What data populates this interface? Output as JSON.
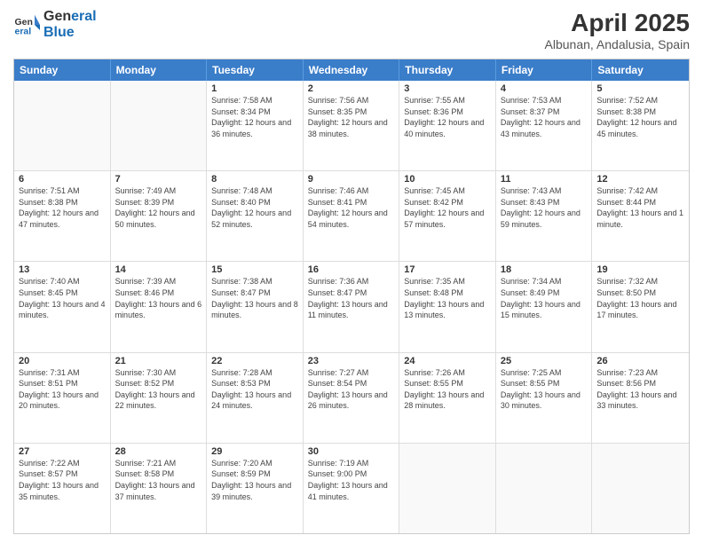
{
  "logo": {
    "line1": "General",
    "line2": "Blue"
  },
  "title": "April 2025",
  "subtitle": "Albunan, Andalusia, Spain",
  "header_days": [
    "Sunday",
    "Monday",
    "Tuesday",
    "Wednesday",
    "Thursday",
    "Friday",
    "Saturday"
  ],
  "rows": [
    [
      {
        "day": "",
        "empty": true
      },
      {
        "day": "",
        "empty": true
      },
      {
        "day": "1",
        "sunrise": "7:58 AM",
        "sunset": "8:34 PM",
        "daylight": "12 hours and 36 minutes."
      },
      {
        "day": "2",
        "sunrise": "7:56 AM",
        "sunset": "8:35 PM",
        "daylight": "12 hours and 38 minutes."
      },
      {
        "day": "3",
        "sunrise": "7:55 AM",
        "sunset": "8:36 PM",
        "daylight": "12 hours and 40 minutes."
      },
      {
        "day": "4",
        "sunrise": "7:53 AM",
        "sunset": "8:37 PM",
        "daylight": "12 hours and 43 minutes."
      },
      {
        "day": "5",
        "sunrise": "7:52 AM",
        "sunset": "8:38 PM",
        "daylight": "12 hours and 45 minutes."
      }
    ],
    [
      {
        "day": "6",
        "sunrise": "7:51 AM",
        "sunset": "8:38 PM",
        "daylight": "12 hours and 47 minutes."
      },
      {
        "day": "7",
        "sunrise": "7:49 AM",
        "sunset": "8:39 PM",
        "daylight": "12 hours and 50 minutes."
      },
      {
        "day": "8",
        "sunrise": "7:48 AM",
        "sunset": "8:40 PM",
        "daylight": "12 hours and 52 minutes."
      },
      {
        "day": "9",
        "sunrise": "7:46 AM",
        "sunset": "8:41 PM",
        "daylight": "12 hours and 54 minutes."
      },
      {
        "day": "10",
        "sunrise": "7:45 AM",
        "sunset": "8:42 PM",
        "daylight": "12 hours and 57 minutes."
      },
      {
        "day": "11",
        "sunrise": "7:43 AM",
        "sunset": "8:43 PM",
        "daylight": "12 hours and 59 minutes."
      },
      {
        "day": "12",
        "sunrise": "7:42 AM",
        "sunset": "8:44 PM",
        "daylight": "13 hours and 1 minute."
      }
    ],
    [
      {
        "day": "13",
        "sunrise": "7:40 AM",
        "sunset": "8:45 PM",
        "daylight": "13 hours and 4 minutes."
      },
      {
        "day": "14",
        "sunrise": "7:39 AM",
        "sunset": "8:46 PM",
        "daylight": "13 hours and 6 minutes."
      },
      {
        "day": "15",
        "sunrise": "7:38 AM",
        "sunset": "8:47 PM",
        "daylight": "13 hours and 8 minutes."
      },
      {
        "day": "16",
        "sunrise": "7:36 AM",
        "sunset": "8:47 PM",
        "daylight": "13 hours and 11 minutes."
      },
      {
        "day": "17",
        "sunrise": "7:35 AM",
        "sunset": "8:48 PM",
        "daylight": "13 hours and 13 minutes."
      },
      {
        "day": "18",
        "sunrise": "7:34 AM",
        "sunset": "8:49 PM",
        "daylight": "13 hours and 15 minutes."
      },
      {
        "day": "19",
        "sunrise": "7:32 AM",
        "sunset": "8:50 PM",
        "daylight": "13 hours and 17 minutes."
      }
    ],
    [
      {
        "day": "20",
        "sunrise": "7:31 AM",
        "sunset": "8:51 PM",
        "daylight": "13 hours and 20 minutes."
      },
      {
        "day": "21",
        "sunrise": "7:30 AM",
        "sunset": "8:52 PM",
        "daylight": "13 hours and 22 minutes."
      },
      {
        "day": "22",
        "sunrise": "7:28 AM",
        "sunset": "8:53 PM",
        "daylight": "13 hours and 24 minutes."
      },
      {
        "day": "23",
        "sunrise": "7:27 AM",
        "sunset": "8:54 PM",
        "daylight": "13 hours and 26 minutes."
      },
      {
        "day": "24",
        "sunrise": "7:26 AM",
        "sunset": "8:55 PM",
        "daylight": "13 hours and 28 minutes."
      },
      {
        "day": "25",
        "sunrise": "7:25 AM",
        "sunset": "8:55 PM",
        "daylight": "13 hours and 30 minutes."
      },
      {
        "day": "26",
        "sunrise": "7:23 AM",
        "sunset": "8:56 PM",
        "daylight": "13 hours and 33 minutes."
      }
    ],
    [
      {
        "day": "27",
        "sunrise": "7:22 AM",
        "sunset": "8:57 PM",
        "daylight": "13 hours and 35 minutes."
      },
      {
        "day": "28",
        "sunrise": "7:21 AM",
        "sunset": "8:58 PM",
        "daylight": "13 hours and 37 minutes."
      },
      {
        "day": "29",
        "sunrise": "7:20 AM",
        "sunset": "8:59 PM",
        "daylight": "13 hours and 39 minutes."
      },
      {
        "day": "30",
        "sunrise": "7:19 AM",
        "sunset": "9:00 PM",
        "daylight": "13 hours and 41 minutes."
      },
      {
        "day": "",
        "empty": true
      },
      {
        "day": "",
        "empty": true
      },
      {
        "day": "",
        "empty": true
      }
    ]
  ],
  "labels": {
    "sunrise_prefix": "Sunrise: ",
    "sunset_prefix": "Sunset: ",
    "daylight_prefix": "Daylight: "
  }
}
